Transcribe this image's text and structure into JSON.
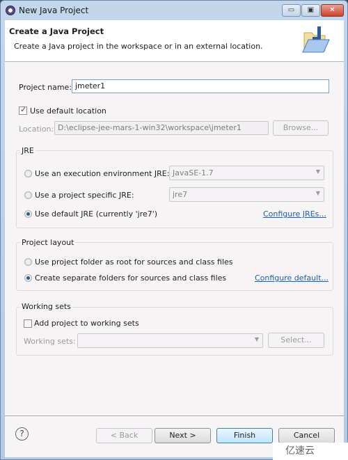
{
  "window": {
    "title": "New Java Project",
    "controls": {
      "minimize": "▭",
      "maximize": "▣",
      "close": "✕"
    }
  },
  "banner": {
    "title": "Create a Java Project",
    "description": "Create a Java project in the workspace or in an external location.",
    "icon": "java-folder-icon"
  },
  "project": {
    "name_label": "Project name:",
    "name_value": "jmeter1",
    "use_default_location_label": "Use default location",
    "use_default_location_checked": true,
    "location_label": "Location:",
    "location_value": "D:\\eclipse-jee-mars-1-win32\\workspace\\jmeter1",
    "browse_label": "Browse..."
  },
  "jre": {
    "group_title": "JRE",
    "options": [
      {
        "label": "Use an execution environment JRE:",
        "selected": false,
        "combo_value": "JavaSE-1.7"
      },
      {
        "label": "Use a project specific JRE:",
        "selected": false,
        "combo_value": "jre7"
      },
      {
        "label": "Use default JRE (currently 'jre7')",
        "selected": true
      }
    ],
    "configure_link": "Configure JREs..."
  },
  "layout": {
    "group_title": "Project layout",
    "options": [
      {
        "label": "Use project folder as root for sources and class files",
        "selected": false
      },
      {
        "label": "Create separate folders for sources and class files",
        "selected": true
      }
    ],
    "configure_link": "Configure default..."
  },
  "working_sets": {
    "group_title": "Working sets",
    "add_label": "Add project to working sets",
    "add_checked": false,
    "sets_label": "Working sets:",
    "sets_value": "",
    "select_label": "Select..."
  },
  "footer": {
    "help": "?",
    "back": "< Back",
    "next": "Next >",
    "finish": "Finish",
    "cancel": "Cancel"
  },
  "watermark": "亿速云"
}
